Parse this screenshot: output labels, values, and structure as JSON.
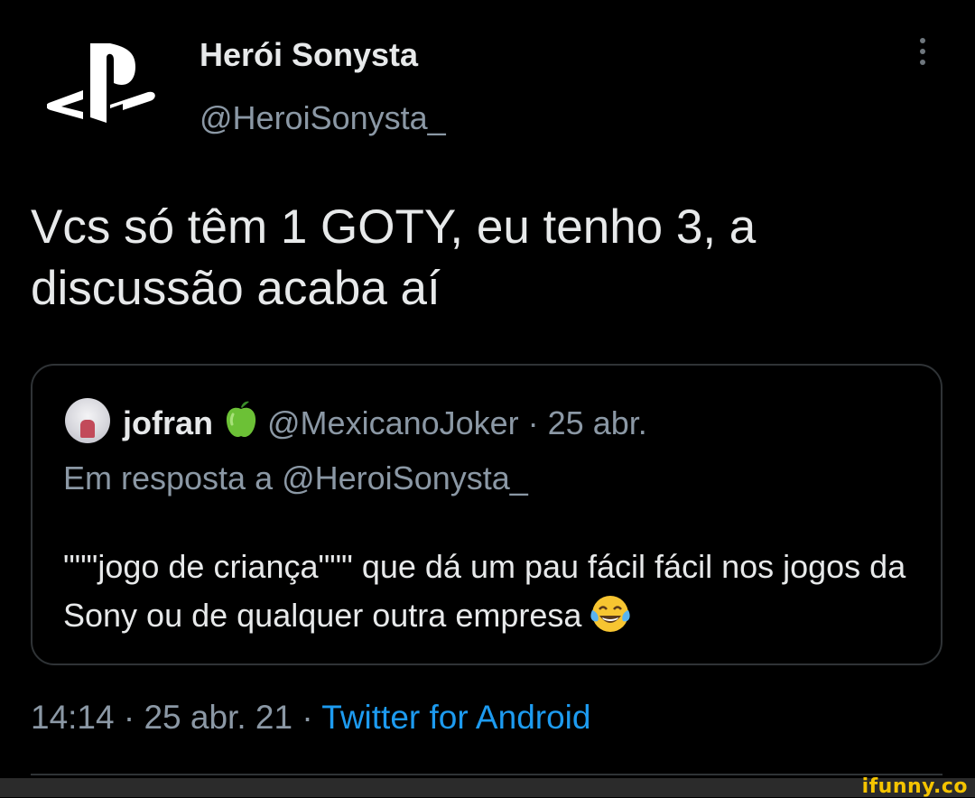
{
  "tweet": {
    "display_name": "Herói Sonysta",
    "handle": "@HeroiSonysta_",
    "text": "Vcs só têm 1 GOTY, eu tenho 3, a discussão acaba aí",
    "timestamp": "14:14 · 25 abr. 21 · ",
    "client": "Twitter for Android"
  },
  "quote": {
    "display_name": "jofran",
    "meta": "@MexicanoJoker · 25 abr.",
    "reply_to": "Em resposta a @HeroiSonysta_",
    "text": "\"\"\"jogo de criança\"\"\" que dá um pau fácil fácil nos jogos da Sony ou de qualquer outra empresa"
  },
  "icons": {
    "avatar": "playstation-logo",
    "more": "more-vertical-icon",
    "apple": "green-apple-icon",
    "emoji": "tears-of-joy-emoji"
  },
  "watermark": "ifunny.co",
  "colors": {
    "background": "#000000",
    "text": "#e7e9ea",
    "muted": "#8b98a5",
    "link": "#1d9bf0",
    "border": "#2f3336",
    "watermark": "#f5c400"
  }
}
